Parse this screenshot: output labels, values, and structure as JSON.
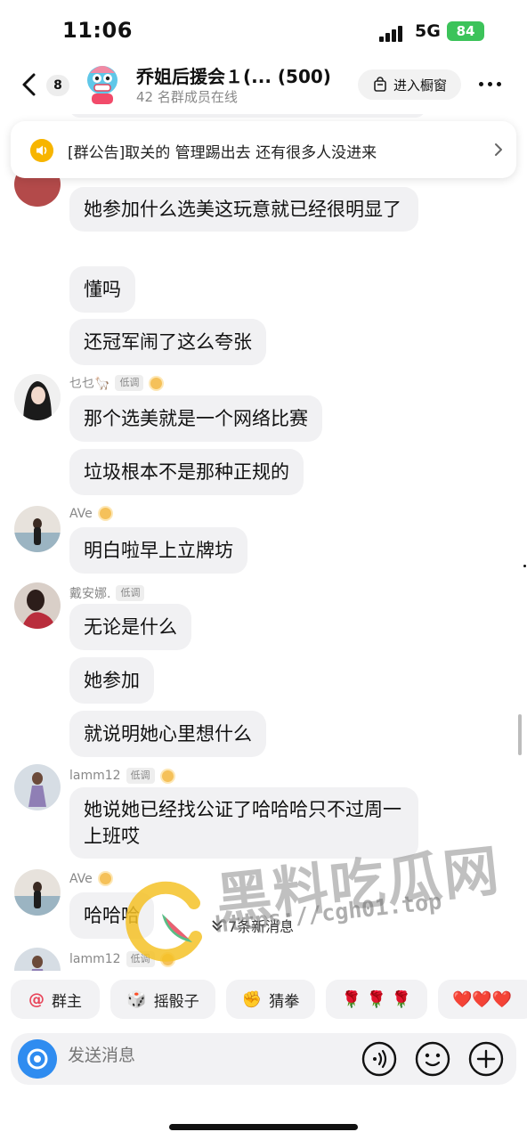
{
  "status": {
    "time": "11:06",
    "network": "5G",
    "battery": "84"
  },
  "header": {
    "unread_count": "8",
    "title": "乔姐后援会１(... (500)",
    "subtitle": "42 名群成员在线",
    "showcase_label": "进入橱窗"
  },
  "notice": {
    "text": "[群公告]取关的 管理踢出去 还有很多人没进来"
  },
  "messages": [
    {
      "text": "她参加什么选美这玩意就已经很明显了"
    },
    {
      "text": "懂吗"
    },
    {
      "text": "还冠军闹了这么夸张"
    },
    {
      "sender": "乜乜🦙",
      "tag": "低调",
      "text": "那个选美就是一个网络比赛"
    },
    {
      "text": "垃圾根本不是那种正规的"
    },
    {
      "sender": "AVe",
      "text": "明白啦早上立牌坊"
    },
    {
      "sender": "戴安娜.",
      "tag": "低调",
      "text": "无论是什么"
    },
    {
      "text": "她参加"
    },
    {
      "text": "就说明她心里想什么"
    },
    {
      "sender": "lamm12",
      "tag": "低调",
      "text": "她说她已经找公证了哈哈哈只不过周一上班哎"
    },
    {
      "sender": "AVe",
      "text": "哈哈哈"
    },
    {
      "sender": "lamm12",
      "tag": "低调"
    }
  ],
  "new_messages": "7条新消息",
  "watermark": {
    "brand": "黑料吃瓜网",
    "url": "https://cgh01.top"
  },
  "quick_actions": [
    {
      "label": "群主",
      "icon": "@"
    },
    {
      "label": "摇骰子",
      "icon": "🎲"
    },
    {
      "label": "猜拳",
      "icon": "✊"
    },
    {
      "label": "",
      "icon": "🌹 🌹 🌹"
    },
    {
      "label": "",
      "icon": "❤️❤️❤️"
    }
  ],
  "input": {
    "placeholder": "发送消息"
  },
  "colors": {
    "accent": "#2f8cf0",
    "battery": "#3cc35a",
    "bubble": "#f1f1f3"
  }
}
